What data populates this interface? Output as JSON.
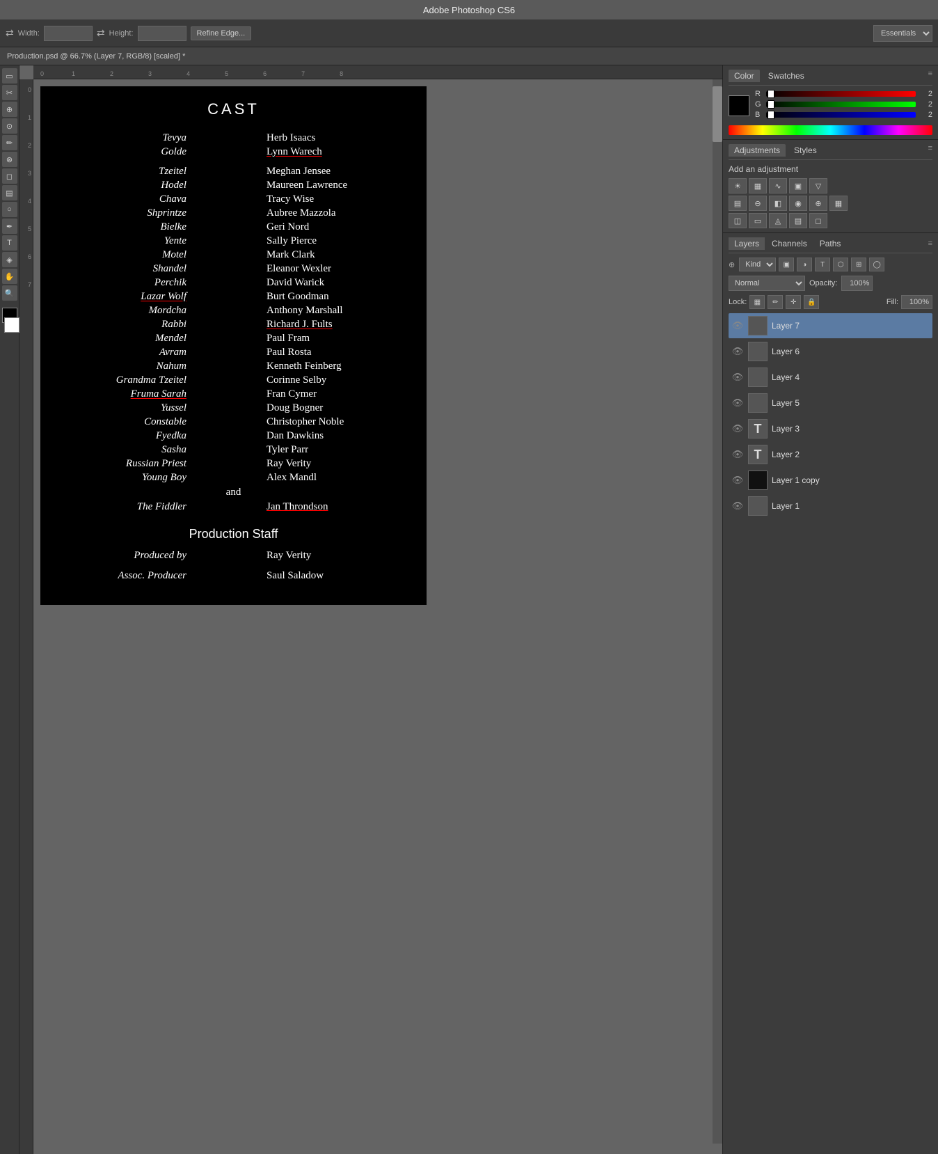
{
  "titleBar": {
    "title": "Adobe Photoshop CS6"
  },
  "toolbar": {
    "widthLabel": "Width:",
    "heightLabel": "Height:",
    "refineEdgeBtn": "Refine Edge...",
    "essentialsLabel": "Essentials"
  },
  "docTab": {
    "label": "Production.psd @ 66.7% (Layer 7, RGB/8) [scaled] *"
  },
  "ruler": {
    "hMarks": [
      "0",
      "1",
      "2",
      "3",
      "4",
      "5",
      "6",
      "7",
      "8"
    ],
    "vMarks": []
  },
  "canvas": {
    "title": "CAST",
    "castRows": [
      {
        "role": "Tevya",
        "name": "Herb Isaacs",
        "roleUnderline": false,
        "nameUnderline": false
      },
      {
        "role": "Golde",
        "name": "Lynn Warech",
        "roleUnderline": false,
        "nameUnderline": true
      },
      {
        "role": "",
        "name": "",
        "roleUnderline": false,
        "nameUnderline": false
      },
      {
        "role": "Tzeitel",
        "name": "Meghan Jensee",
        "roleUnderline": false,
        "nameUnderline": false
      },
      {
        "role": "Hodel",
        "name": "Maureen Lawrence",
        "roleUnderline": false,
        "nameUnderline": false
      },
      {
        "role": "Chava",
        "name": "Tracy Wise",
        "roleUnderline": false,
        "nameUnderline": false
      },
      {
        "role": "Shprintze",
        "name": "Aubree Mazzola",
        "roleUnderline": false,
        "nameUnderline": false
      },
      {
        "role": "Bielke",
        "name": "Geri Nord",
        "roleUnderline": false,
        "nameUnderline": false
      },
      {
        "role": "Yente",
        "name": "Sally Pierce",
        "roleUnderline": false,
        "nameUnderline": false
      },
      {
        "role": "Motel",
        "name": "Mark Clark",
        "roleUnderline": false,
        "nameUnderline": false
      },
      {
        "role": "Shandel",
        "name": "Eleanor Wexler",
        "roleUnderline": false,
        "nameUnderline": false
      },
      {
        "role": "Perchik",
        "name": "David Warick",
        "roleUnderline": false,
        "nameUnderline": false
      },
      {
        "role": "Lazar Wolf",
        "name": "Burt Goodman",
        "roleUnderline": true,
        "nameUnderline": false
      },
      {
        "role": "Mordcha",
        "name": "Anthony Marshall",
        "roleUnderline": false,
        "nameUnderline": false
      },
      {
        "role": "Rabbi",
        "name": "Richard J. Fults",
        "roleUnderline": false,
        "nameUnderline": true
      },
      {
        "role": "Mendel",
        "name": "Paul Fram",
        "roleUnderline": false,
        "nameUnderline": false
      },
      {
        "role": "Avram",
        "name": "Paul Rosta",
        "roleUnderline": false,
        "nameUnderline": false
      },
      {
        "role": "Nahum",
        "name": "Kenneth Feinberg",
        "roleUnderline": false,
        "nameUnderline": false
      },
      {
        "role": "Grandma Tzeitel",
        "name": "Corinne Selby",
        "roleUnderline": false,
        "nameUnderline": false
      },
      {
        "role": "Fruma Sarah",
        "name": "Fran Cymer",
        "roleUnderline": true,
        "nameUnderline": false
      },
      {
        "role": "Yussel",
        "name": "Doug Bogner",
        "roleUnderline": false,
        "nameUnderline": false
      },
      {
        "role": "Constable",
        "name": "Christopher Noble",
        "roleUnderline": false,
        "nameUnderline": false
      },
      {
        "role": "Fyedka",
        "name": "Dan Dawkins",
        "roleUnderline": false,
        "nameUnderline": false
      },
      {
        "role": "Sasha",
        "name": "Tyler Parr",
        "roleUnderline": false,
        "nameUnderline": false
      },
      {
        "role": "Russian Priest",
        "name": "Ray Verity",
        "roleUnderline": false,
        "nameUnderline": false
      },
      {
        "role": "Young Boy",
        "name": "Alex Mandl",
        "roleUnderline": false,
        "nameUnderline": false
      }
    ],
    "andText": "and",
    "fiddlerRole": "The Fiddler",
    "fiddlerName": "Jan Throndson",
    "sectionTitle": "Production Staff",
    "productionRows": [
      {
        "role": "Produced by",
        "name": "Ray Verity"
      },
      {
        "role": "Assoc. Producer",
        "name": "Saul Saladow"
      }
    ]
  },
  "colorPanel": {
    "tab1": "Color",
    "tab2": "Swatches",
    "rLabel": "R",
    "gLabel": "G",
    "bLabel": "B",
    "rVal": "2",
    "gVal": "2",
    "bVal": "2"
  },
  "adjustmentsPanel": {
    "tab1": "Adjustments",
    "tab2": "Styles",
    "addLabel": "Add an adjustment"
  },
  "layersPanel": {
    "tab1": "Layers",
    "tab2": "Channels",
    "tab3": "Paths",
    "kindLabel": "Kind",
    "blendMode": "Normal",
    "opacityLabel": "Opacity:",
    "opacityVal": "100%",
    "lockLabel": "Lock:",
    "fillLabel": "Fill:",
    "fillVal": "100%",
    "layers": [
      {
        "name": "Layer 7",
        "type": "image",
        "active": true,
        "visible": true
      },
      {
        "name": "Layer 6",
        "type": "image",
        "active": false,
        "visible": true
      },
      {
        "name": "Layer 4",
        "type": "image",
        "active": false,
        "visible": true
      },
      {
        "name": "Layer 5",
        "type": "image",
        "active": false,
        "visible": true
      },
      {
        "name": "Layer 3",
        "type": "text",
        "active": false,
        "visible": true
      },
      {
        "name": "Layer 2",
        "type": "text",
        "active": false,
        "visible": true
      },
      {
        "name": "Layer 1 copy",
        "type": "image-dark",
        "active": false,
        "visible": true
      },
      {
        "name": "Layer 1",
        "type": "image",
        "active": false,
        "visible": true
      }
    ]
  }
}
